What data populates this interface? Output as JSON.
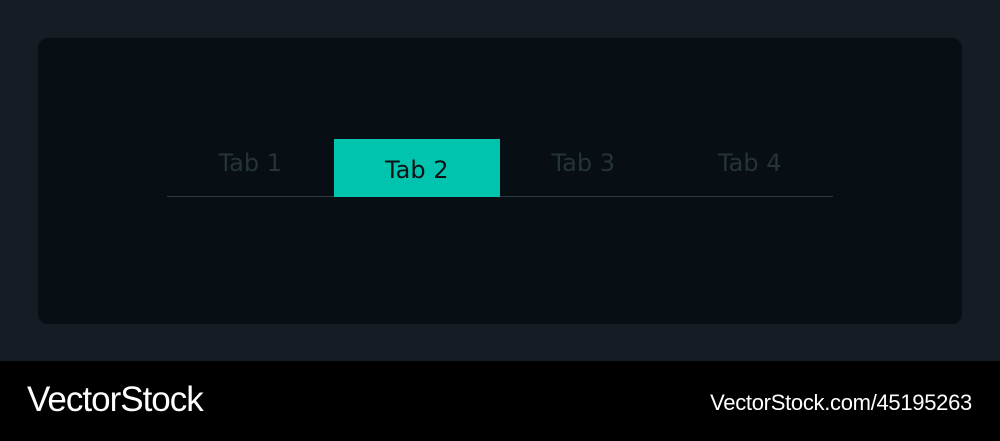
{
  "tabs": [
    {
      "label": "Tab 1",
      "active": false
    },
    {
      "label": "Tab 2",
      "active": true
    },
    {
      "label": "Tab 3",
      "active": false
    },
    {
      "label": "Tab 4",
      "active": false
    }
  ],
  "colors": {
    "page_background": "#161c23",
    "card_background": "#070e14",
    "accent": "#00c4ad",
    "inactive_tab_text": "#25333a",
    "active_tab_text": "#0c1216",
    "footer_background": "#000000"
  },
  "footer": {
    "brand": "VectorStock",
    "id_text": "VectorStock.com/45195263"
  }
}
